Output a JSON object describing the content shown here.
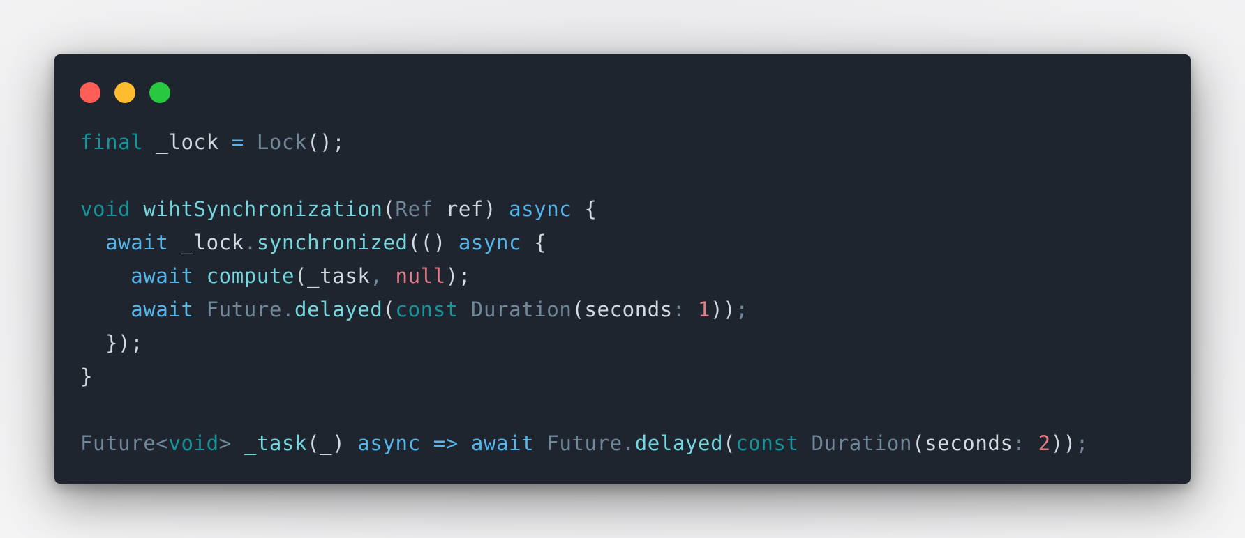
{
  "window": {
    "controls": [
      {
        "name": "close-button",
        "color": "#ff5f57"
      },
      {
        "name": "minimize-button",
        "color": "#febc2e"
      },
      {
        "name": "zoom-button",
        "color": "#28c840"
      }
    ]
  },
  "colors": {
    "background": "#1e252e",
    "keyword": "#16949c",
    "keyword_async": "#55b6ec",
    "function": "#74d6de",
    "type": "#6f8799",
    "text": "#d5dae0",
    "literal": "#e27b86"
  },
  "code": {
    "lines": [
      [
        {
          "t": "final",
          "c": "kw"
        },
        {
          "t": " _lock ",
          "c": "id"
        },
        {
          "t": "=",
          "c": "op"
        },
        {
          "t": " ",
          "c": "id"
        },
        {
          "t": "Lock",
          "c": "type"
        },
        {
          "t": "();",
          "c": "punc"
        }
      ],
      [],
      [
        {
          "t": "void",
          "c": "kw"
        },
        {
          "t": " ",
          "c": "id"
        },
        {
          "t": "wihtSynchronization",
          "c": "fn"
        },
        {
          "t": "(",
          "c": "punc"
        },
        {
          "t": "Ref",
          "c": "type"
        },
        {
          "t": " ref) ",
          "c": "id"
        },
        {
          "t": "async",
          "c": "kw2"
        },
        {
          "t": " {",
          "c": "punc"
        }
      ],
      [
        {
          "t": "  ",
          "c": "id"
        },
        {
          "t": "await",
          "c": "kw2"
        },
        {
          "t": " _lock",
          "c": "id"
        },
        {
          "t": ".",
          "c": "dim"
        },
        {
          "t": "synchronized",
          "c": "fn"
        },
        {
          "t": "(() ",
          "c": "punc"
        },
        {
          "t": "async",
          "c": "kw2"
        },
        {
          "t": " {",
          "c": "punc"
        }
      ],
      [
        {
          "t": "    ",
          "c": "id"
        },
        {
          "t": "await",
          "c": "kw2"
        },
        {
          "t": " ",
          "c": "id"
        },
        {
          "t": "compute",
          "c": "fn"
        },
        {
          "t": "(_task",
          "c": "punc"
        },
        {
          "t": ", ",
          "c": "dim"
        },
        {
          "t": "null",
          "c": "null"
        },
        {
          "t": ");",
          "c": "punc"
        }
      ],
      [
        {
          "t": "    ",
          "c": "id"
        },
        {
          "t": "await",
          "c": "kw2"
        },
        {
          "t": " ",
          "c": "id"
        },
        {
          "t": "Future",
          "c": "type"
        },
        {
          "t": ".",
          "c": "dim"
        },
        {
          "t": "delayed",
          "c": "fn"
        },
        {
          "t": "(",
          "c": "punc"
        },
        {
          "t": "const",
          "c": "kw"
        },
        {
          "t": " ",
          "c": "id"
        },
        {
          "t": "Duration",
          "c": "type"
        },
        {
          "t": "(seconds",
          "c": "punc"
        },
        {
          "t": ": ",
          "c": "dim"
        },
        {
          "t": "1",
          "c": "num"
        },
        {
          "t": "))",
          "c": "punc"
        },
        {
          "t": ";",
          "c": "dim"
        }
      ],
      [
        {
          "t": "  });",
          "c": "punc"
        }
      ],
      [
        {
          "t": "}",
          "c": "punc"
        }
      ],
      [],
      [
        {
          "t": "Future",
          "c": "type"
        },
        {
          "t": "<",
          "c": "dim"
        },
        {
          "t": "void",
          "c": "kw"
        },
        {
          "t": "> ",
          "c": "dim"
        },
        {
          "t": "_task",
          "c": "fn"
        },
        {
          "t": "(_) ",
          "c": "punc"
        },
        {
          "t": "async",
          "c": "kw2"
        },
        {
          "t": " ",
          "c": "id"
        },
        {
          "t": "=>",
          "c": "op"
        },
        {
          "t": " ",
          "c": "id"
        },
        {
          "t": "await",
          "c": "kw2"
        },
        {
          "t": " ",
          "c": "id"
        },
        {
          "t": "Future",
          "c": "type"
        },
        {
          "t": ".",
          "c": "dim"
        },
        {
          "t": "delayed",
          "c": "fn"
        },
        {
          "t": "(",
          "c": "punc"
        },
        {
          "t": "const",
          "c": "kw"
        },
        {
          "t": " ",
          "c": "id"
        },
        {
          "t": "Duration",
          "c": "type"
        },
        {
          "t": "(seconds",
          "c": "punc"
        },
        {
          "t": ": ",
          "c": "dim"
        },
        {
          "t": "2",
          "c": "num"
        },
        {
          "t": "))",
          "c": "punc"
        },
        {
          "t": ";",
          "c": "dim"
        }
      ]
    ]
  }
}
